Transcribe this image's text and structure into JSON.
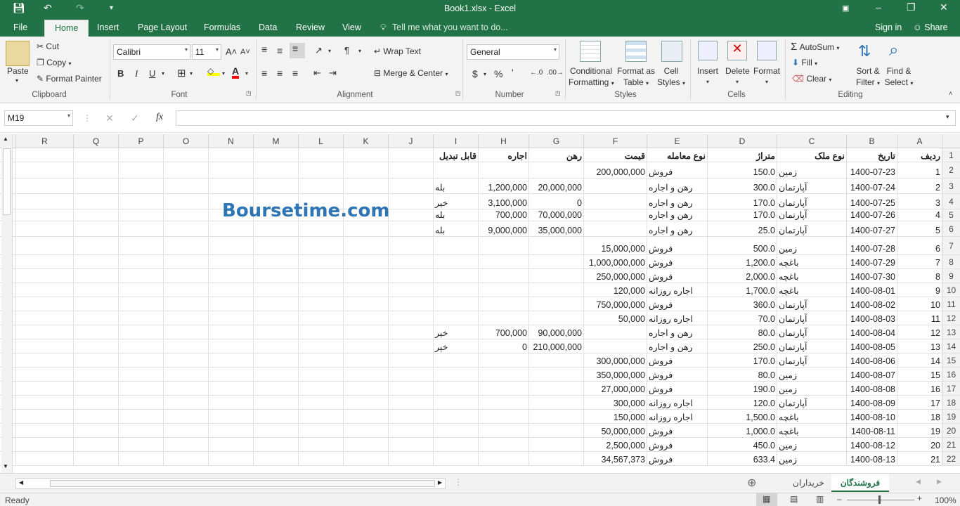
{
  "window": {
    "title": "Book1.xlsx - Excel"
  },
  "quick_access": {
    "save": "save-icon",
    "undo": "undo-icon",
    "redo": "redo-icon"
  },
  "tabs": [
    "File",
    "Home",
    "Insert",
    "Page Layout",
    "Formulas",
    "Data",
    "Review",
    "View"
  ],
  "tell_me": "Tell me what you want to do...",
  "account": {
    "signin": "Sign in",
    "share": "Share"
  },
  "ribbon": {
    "clipboard": {
      "paste": "Paste",
      "cut": "Cut",
      "copy": "Copy",
      "format_painter": "Format Painter",
      "label": "Clipboard"
    },
    "font": {
      "name": "Calibri",
      "size": "11",
      "bold": "B",
      "italic": "I",
      "underline": "U",
      "label": "Font"
    },
    "alignment": {
      "wrap": "Wrap Text",
      "merge": "Merge & Center",
      "label": "Alignment"
    },
    "number": {
      "format": "General",
      "label": "Number"
    },
    "styles": {
      "conditional": "Conditional",
      "conditional2": "Formatting",
      "format_table": "Format as",
      "format_table2": "Table",
      "cell_styles": "Cell",
      "cell_styles2": "Styles",
      "label": "Styles"
    },
    "cells": {
      "insert": "Insert",
      "delete": "Delete",
      "format": "Format",
      "label": "Cells"
    },
    "editing": {
      "autosum": "AutoSum",
      "fill": "Fill",
      "clear": "Clear",
      "sort": "Sort &",
      "sort2": "Filter",
      "find": "Find &",
      "find2": "Select",
      "label": "Editing"
    }
  },
  "namebox": "M19",
  "formula": "",
  "columns": [
    "R",
    "Q",
    "P",
    "O",
    "N",
    "M",
    "L",
    "K",
    "J",
    "I",
    "H",
    "G",
    "F",
    "E",
    "D",
    "C",
    "B",
    "A"
  ],
  "headers": {
    "A": "ردیف",
    "B": "تاریخ",
    "C": "نوع ملک",
    "D": "متراژ",
    "E": "نوع معامله",
    "F": "قیمت",
    "G": "رهن",
    "H": "اجاره",
    "I": "قابل تبدیل"
  },
  "rows": [
    {
      "n": "2",
      "A": "1",
      "B": "1400-07-23",
      "C": "زمین",
      "D": "150.0",
      "E": "فروش",
      "F": "200,000,000",
      "G": "",
      "H": "",
      "I": ""
    },
    {
      "n": "3",
      "A": "2",
      "B": "1400-07-24",
      "C": "آپارتمان",
      "D": "300.0",
      "E": "رهن و اجاره",
      "F": "",
      "G": "20,000,000",
      "H": "1,200,000",
      "I": "بله"
    },
    {
      "n": "4",
      "A": "3",
      "B": "1400-07-25",
      "C": "آپارتمان",
      "D": "170.0",
      "E": "رهن و اجاره",
      "F": "",
      "G": "0",
      "H": "3,100,000",
      "I": "خیر"
    },
    {
      "n": "5",
      "A": "4",
      "B": "1400-07-26",
      "C": "آپارتمان",
      "D": "170.0",
      "E": "رهن و اجاره",
      "F": "",
      "G": "70,000,000",
      "H": "700,000",
      "I": "بله"
    },
    {
      "n": "6",
      "A": "5",
      "B": "1400-07-27",
      "C": "آپارتمان",
      "D": "25.0",
      "E": "رهن و اجاره",
      "F": "",
      "G": "35,000,000",
      "H": "9,000,000",
      "I": "بله"
    },
    {
      "n": "7",
      "A": "6",
      "B": "1400-07-28",
      "C": "زمین",
      "D": "500.0",
      "E": "فروش",
      "F": "15,000,000",
      "G": "",
      "H": "",
      "I": ""
    },
    {
      "n": "8",
      "A": "7",
      "B": "1400-07-29",
      "C": "باغچه",
      "D": "1,200.0",
      "E": "فروش",
      "F": "1,000,000,000",
      "G": "",
      "H": "",
      "I": ""
    },
    {
      "n": "9",
      "A": "8",
      "B": "1400-07-30",
      "C": "باغچه",
      "D": "2,000.0",
      "E": "فروش",
      "F": "250,000,000",
      "G": "",
      "H": "",
      "I": ""
    },
    {
      "n": "10",
      "A": "9",
      "B": "1400-08-01",
      "C": "باغچه",
      "D": "1,700.0",
      "E": "اجاره روزانه",
      "F": "120,000",
      "G": "",
      "H": "",
      "I": ""
    },
    {
      "n": "11",
      "A": "10",
      "B": "1400-08-02",
      "C": "آپارتمان",
      "D": "360.0",
      "E": "فروش",
      "F": "750,000,000",
      "G": "",
      "H": "",
      "I": ""
    },
    {
      "n": "12",
      "A": "11",
      "B": "1400-08-03",
      "C": "آپارتمان",
      "D": "70.0",
      "E": "اجاره روزانه",
      "F": "50,000",
      "G": "",
      "H": "",
      "I": ""
    },
    {
      "n": "13",
      "A": "12",
      "B": "1400-08-04",
      "C": "آپارتمان",
      "D": "80.0",
      "E": "رهن و اجاره",
      "F": "",
      "G": "90,000,000",
      "H": "700,000",
      "I": "خیر"
    },
    {
      "n": "14",
      "A": "13",
      "B": "1400-08-05",
      "C": "آپارتمان",
      "D": "250.0",
      "E": "رهن و اجاره",
      "F": "",
      "G": "210,000,000",
      "H": "0",
      "I": "خیر"
    },
    {
      "n": "15",
      "A": "14",
      "B": "1400-08-06",
      "C": "آپارتمان",
      "D": "170.0",
      "E": "فروش",
      "F": "300,000,000",
      "G": "",
      "H": "",
      "I": ""
    },
    {
      "n": "16",
      "A": "15",
      "B": "1400-08-07",
      "C": "زمین",
      "D": "80.0",
      "E": "فروش",
      "F": "350,000,000",
      "G": "",
      "H": "",
      "I": ""
    },
    {
      "n": "17",
      "A": "16",
      "B": "1400-08-08",
      "C": "زمین",
      "D": "190.0",
      "E": "فروش",
      "F": "27,000,000",
      "G": "",
      "H": "",
      "I": ""
    },
    {
      "n": "18",
      "A": "17",
      "B": "1400-08-09",
      "C": "آپارتمان",
      "D": "120.0",
      "E": "اجاره روزانه",
      "F": "300,000",
      "G": "",
      "H": "",
      "I": ""
    },
    {
      "n": "19",
      "A": "18",
      "B": "1400-08-10",
      "C": "باغچه",
      "D": "1,500.0",
      "E": "اجاره روزانه",
      "F": "150,000",
      "G": "",
      "H": "",
      "I": ""
    },
    {
      "n": "20",
      "A": "19",
      "B": "1400-08-11",
      "C": "باغچه",
      "D": "1,000.0",
      "E": "فروش",
      "F": "50,000,000",
      "G": "",
      "H": "",
      "I": ""
    },
    {
      "n": "21",
      "A": "20",
      "B": "1400-08-12",
      "C": "زمین",
      "D": "450.0",
      "E": "فروش",
      "F": "2,500,000",
      "G": "",
      "H": "",
      "I": ""
    },
    {
      "n": "22",
      "A": "21",
      "B": "1400-08-13",
      "C": "زمین",
      "D": "633.4",
      "E": "فروش",
      "F": "34,567,373",
      "G": "",
      "H": "",
      "I": ""
    }
  ],
  "watermark": "Boursetime.com",
  "sheets": [
    "خریداران",
    "فروشندگان"
  ],
  "active_sheet": "فروشندگان",
  "status": {
    "ready": "Ready",
    "zoom": "100%"
  }
}
